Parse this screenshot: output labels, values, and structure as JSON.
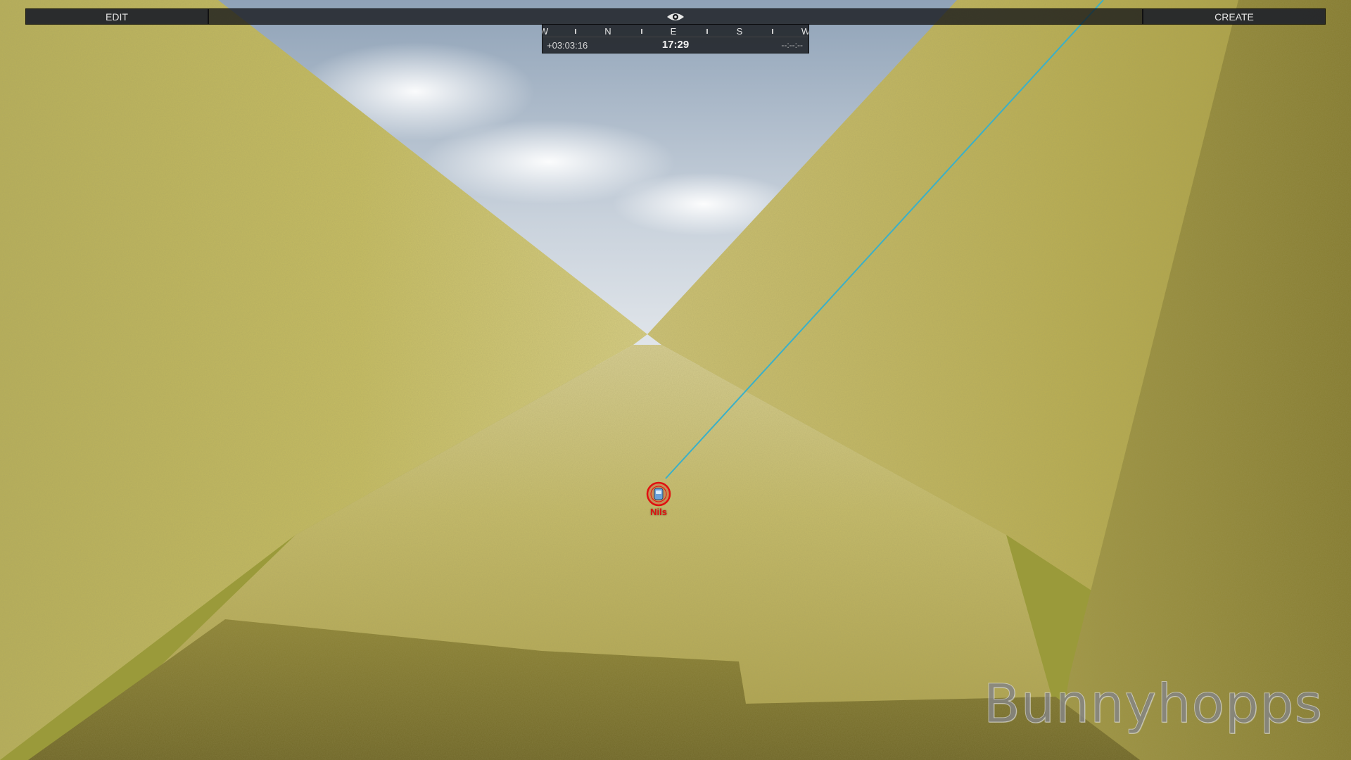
{
  "toolbar": {
    "edit_label": "EDIT",
    "create_label": "CREATE",
    "center_icon": "eye-icon"
  },
  "compass": {
    "directions": [
      {
        "label": "W"
      },
      {
        "label": "N"
      },
      {
        "label": "E"
      },
      {
        "label": "S"
      },
      {
        "label": "W"
      }
    ]
  },
  "time": {
    "elapsed": "+03:03:16",
    "clock": "17:29",
    "remaining": "--:--:--"
  },
  "player": {
    "name": "Nils",
    "marker_color": "#e01010",
    "waypoint_line_color": "#3ab0c8"
  },
  "watermark": "Bunnyhopps",
  "colors": {
    "sky": "#c8d2dc",
    "terrain": "#b5ad52",
    "hud_background": "#16181c"
  }
}
